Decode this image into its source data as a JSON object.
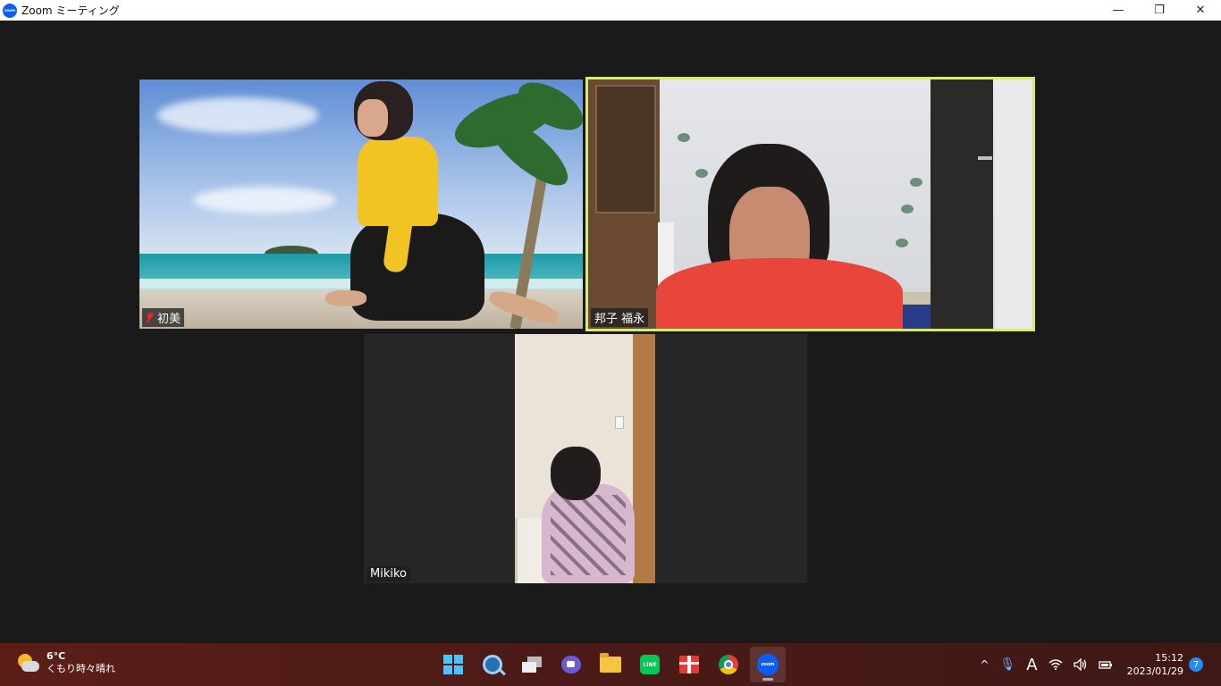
{
  "window": {
    "title": "Zoom ミーティング",
    "app_icon_text": "zoom",
    "controls": {
      "minimize": "—",
      "restore": "❐",
      "close": "✕"
    }
  },
  "meeting": {
    "participants": [
      {
        "name": "初美",
        "muted": true,
        "active_speaker": false
      },
      {
        "name": "邦子 福永",
        "muted": false,
        "active_speaker": true
      },
      {
        "name": "Mikiko",
        "muted": false,
        "active_speaker": false
      }
    ],
    "colors": {
      "active_border": "#d7e97a",
      "muted": "#e02828"
    }
  },
  "taskbar": {
    "weather": {
      "temp": "6°C",
      "condition": "くもり時々晴れ"
    },
    "apps": [
      {
        "name": "start",
        "icon": "windows-icon"
      },
      {
        "name": "search",
        "icon": "search-icon"
      },
      {
        "name": "task-view",
        "icon": "task-view-icon"
      },
      {
        "name": "chat",
        "icon": "chat-icon"
      },
      {
        "name": "file-explorer",
        "icon": "folder-icon"
      },
      {
        "name": "line",
        "icon": "line-icon",
        "label": "LINE"
      },
      {
        "name": "gift",
        "icon": "gift-icon"
      },
      {
        "name": "chrome",
        "icon": "chrome-icon"
      },
      {
        "name": "zoom",
        "icon": "zoom-icon",
        "label": "zoom",
        "active": true
      }
    ],
    "tray": {
      "chevron": "^",
      "ime": "A",
      "time": "15:12",
      "date": "2023/01/29",
      "notifications": "7"
    }
  }
}
